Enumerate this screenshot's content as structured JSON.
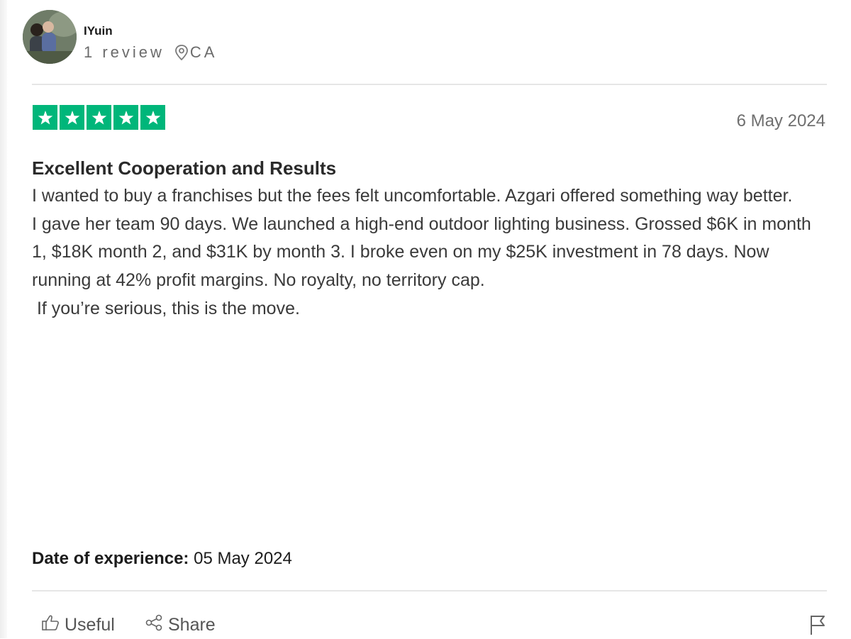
{
  "reviewer": {
    "name": "IYuin",
    "review_count": "1 review",
    "country": "CA"
  },
  "review": {
    "rating": 5,
    "rating_max": 5,
    "date": "6 May 2024",
    "title": "Excellent Cooperation and Results",
    "paragraphs": [
      "I wanted to buy a franchises but the fees felt uncomfortable. Azgari offered something way better.",
      "I gave her team 90 days. We launched a high-end outdoor lighting business. Grossed $6K in month 1, $18K month 2, and $31K by month 3. I broke even on my $25K investment in 78 days. Now running at 42% profit margins. No royalty, no territory cap.",
      " If you’re serious, this is the move."
    ],
    "experience_label": "Date of experience:",
    "experience_date": "05 May 2024"
  },
  "actions": {
    "useful_label": "Useful",
    "share_label": "Share"
  },
  "icons": {
    "star": "star-icon",
    "location": "location-pin-icon",
    "useful": "thumbs-up-icon",
    "share": "share-icon",
    "report": "flag-icon"
  },
  "colors": {
    "star_green": "#00b67a"
  }
}
